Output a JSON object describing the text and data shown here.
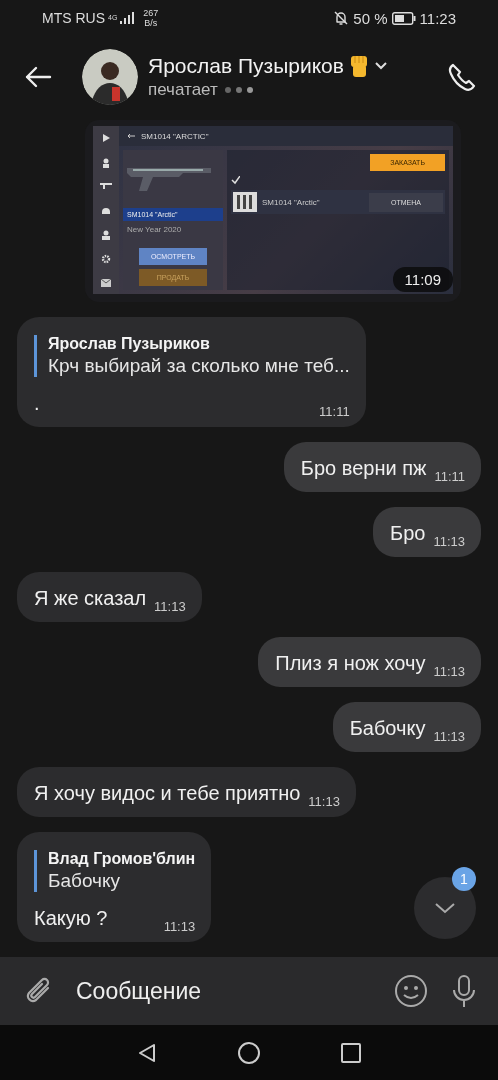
{
  "status_bar": {
    "carrier": "MTS RUS",
    "network": "4G",
    "speed_value": "267",
    "speed_unit": "B/s",
    "battery_percent": "50 %",
    "time": "11:23"
  },
  "header": {
    "name": "Ярослав Пузыриков",
    "status": "печатает"
  },
  "messages": [
    {
      "kind": "image",
      "outgoing": true,
      "time": "11:09",
      "shot": {
        "title": "SM1014 \"ARCTIC\"",
        "item_name": "SM1014 \"Arctic\"",
        "collection": "New Year 2020",
        "inspect_button": "ОСМОТРЕТЬ",
        "sell_button": "ПРОДАТЬ",
        "order_button": "ЗАКАЗАТЬ",
        "filter_checked": true,
        "row_item": "SM1014 \"Arctic\"",
        "cancel_button": "ОТМЕНА"
      }
    },
    {
      "kind": "reply",
      "outgoing": false,
      "quote_author": "Ярослав Пузыриков",
      "quote_text": "Крч выбирай за сколько мне теб...",
      "text": ".",
      "time": "11:11"
    },
    {
      "kind": "text",
      "outgoing": true,
      "text": "Бро верни пж",
      "time": "11:11"
    },
    {
      "kind": "text",
      "outgoing": true,
      "text": "Бро",
      "time": "11:13"
    },
    {
      "kind": "text",
      "outgoing": false,
      "text": "Я же сказал",
      "time": "11:13"
    },
    {
      "kind": "text",
      "outgoing": true,
      "text": "Плиз я нож хочу",
      "time": "11:13"
    },
    {
      "kind": "text",
      "outgoing": true,
      "text": "Бабочку",
      "time": "11:13"
    },
    {
      "kind": "text",
      "outgoing": false,
      "text": "Я хочу видос и тебе приятно",
      "time": "11:13"
    },
    {
      "kind": "reply",
      "outgoing": false,
      "quote_author": "Влад Громов'блин",
      "quote_text": "Бабочку",
      "text": "Какую ?",
      "time": "11:13"
    }
  ],
  "scroll_down": {
    "unread_badge": "1"
  },
  "composer": {
    "placeholder": "Сообщение"
  }
}
